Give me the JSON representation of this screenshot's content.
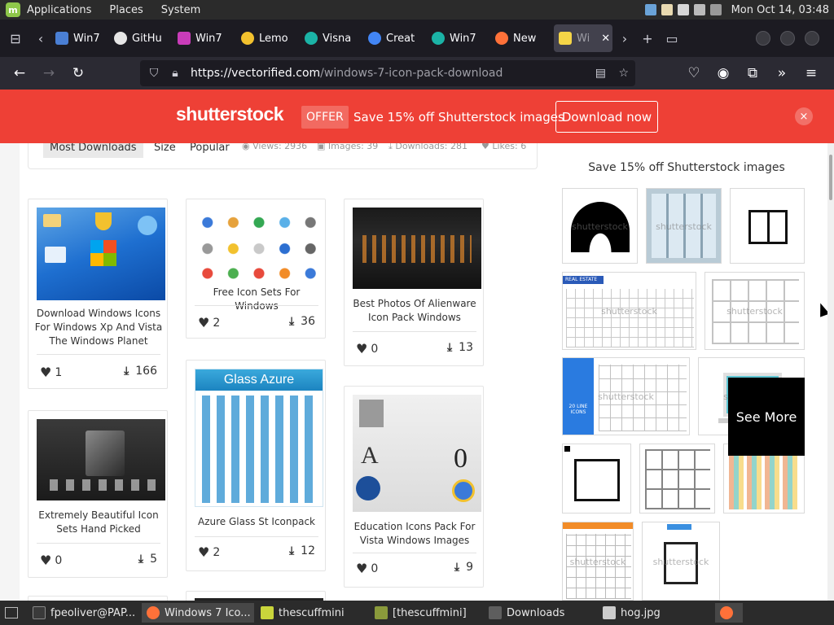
{
  "system_panel": {
    "menus": [
      "Applications",
      "Places",
      "System"
    ],
    "clock": "Mon Oct 14, 03:48"
  },
  "tabs": [
    {
      "label": "Win7",
      "color": "#4a7fd4"
    },
    {
      "label": "GitHu",
      "color": "#e6e6e6"
    },
    {
      "label": "Win7",
      "color": "#c93cb9"
    },
    {
      "label": "Lemo",
      "color": "#f2c12e"
    },
    {
      "label": "Visna",
      "color": "#1bb3a6"
    },
    {
      "label": "Creat",
      "color": "#4285f4"
    },
    {
      "label": "Win7",
      "color": "#1bb3a6"
    },
    {
      "label": "New",
      "color": "#ff7139"
    },
    {
      "label": "Wi",
      "color": "#f5d547"
    }
  ],
  "address": {
    "host": "https://vectorified.com",
    "path": "/windows-7-icon-pack-download"
  },
  "banner": {
    "logo": "shutterstock",
    "offer": "OFFER",
    "text": "Save 15% off Shutterstock images",
    "button": "Download now",
    "close": "×"
  },
  "filters": {
    "most": "Most Downloads",
    "size": "Size",
    "popular": "Popular",
    "views": "Views: 2936",
    "images": "Images: 39",
    "downloads": "Downloads: 281",
    "likes": "Likes: 6"
  },
  "cards": [
    {
      "title": "Download Windows Icons For Windows Xp And Vista The Windows Planet",
      "likes": "1",
      "downloads": "166"
    },
    {
      "title": "Free Icon Sets For Windows",
      "likes": "2",
      "downloads": "36"
    },
    {
      "title": "Best Photos Of Alienware Icon Pack Windows",
      "likes": "0",
      "downloads": "13"
    },
    {
      "title": "Extremely Beautiful Icon Sets Hand Picked",
      "likes": "0",
      "downloads": "5"
    },
    {
      "title": "Azure Glass St Iconpack",
      "thumb_label": "Glass Azure",
      "likes": "2",
      "downloads": "12"
    },
    {
      "title": "Education Icons Pack For Vista Windows Images",
      "likes": "0",
      "downloads": "9"
    }
  ],
  "sidebar": {
    "title": "Save 15% off Shutterstock images",
    "watermark": "shutterstock",
    "real_estate": "REAL ESTATE",
    "line_icons": "20 LINE ICONS",
    "see_more": "See More"
  },
  "taskbar": [
    {
      "label": "fpeoliver@PAP...",
      "color": "#3a3a3a"
    },
    {
      "label": "Windows 7 Ico...",
      "color": "#ff7139"
    },
    {
      "label": "thescuffmini",
      "color": "#c9d53b"
    },
    {
      "label": "[thescuffmini]",
      "color": "#8a9a3b"
    },
    {
      "label": "Downloads",
      "color": "#5e5e5e"
    },
    {
      "label": "hog.jpg",
      "color": "#cccccc"
    }
  ]
}
